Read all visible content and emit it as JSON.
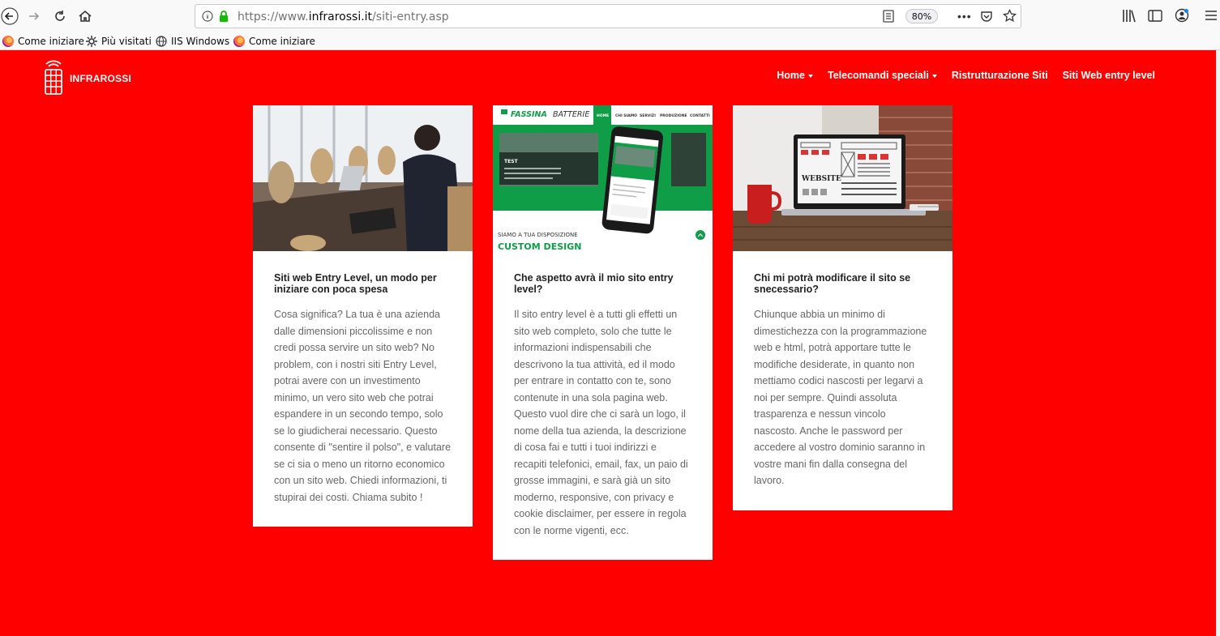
{
  "browser": {
    "url_prefix": "https://www.",
    "url_domain": "infrarossi.it",
    "url_path": "/siti-entry.asp",
    "zoom": "80%",
    "bookmarks": [
      {
        "label": "Come iniziare",
        "icon": "firefox-icon"
      },
      {
        "label": "Più visitati",
        "icon": "gear-icon"
      },
      {
        "label": "IIS Windows",
        "icon": "globe-icon"
      },
      {
        "label": "Come iniziare",
        "icon": "firefox-icon"
      }
    ]
  },
  "site": {
    "logo_text": "INFRAROSSI",
    "menu": [
      {
        "label": "Home",
        "dropdown": true
      },
      {
        "label": "Telecomandi speciali",
        "dropdown": true
      },
      {
        "label": "Ristrutturazione Siti",
        "dropdown": false
      },
      {
        "label": "Siti Web entry level",
        "dropdown": false
      }
    ],
    "accent_color": "#ff0000"
  },
  "cards": [
    {
      "image": "office-photo",
      "title": "Siti web Entry Level, un modo per iniziare con poca spesa",
      "text": "Cosa significa? La tua è una azienda dalle dimensioni piccolissime e non credi possa servire un sito web? No problem, con i nostri siti Entry Level, potrai avere con un investimento minimo, un vero sito web che potrai espandere in un secondo tempo, solo se lo giudicherai necessario. Questo consente di \"sentire il polso\", e valutare se ci sia o meno un ritorno economico con un sito web. Chiedi informazioni, ti stupirai dei costi. Chiama subito !"
    },
    {
      "image": "fassina-mockup",
      "image_texts": {
        "brand_a": "FASSINA",
        "brand_b": "BATTERIE",
        "nav": [
          "HOME",
          "CHI SIAMO",
          "SERVIZI",
          "PRODUZIONE",
          "CONTATTI"
        ],
        "test": "TEST",
        "tagline": "SIAMO A TUA DISPOSIZIONE",
        "headline": "CUSTOM DESIGN"
      },
      "title": "Che aspetto avrà il mio sito entry level?",
      "text": "Il sito entry level è a tutti gli effetti un sito web completo, solo che tutte le informazioni indispensabili che descrivono la tua attività, ed il modo per entrare in contatto con te, sono contenute in una sola pagina web. Questo vuol dire che ci sarà un logo, il nome della tua azienda, la descrizione di cosa fai e tutti i tuoi indirizzi e recapiti telefonici, email, fax, un paio di grosse immagini, e sarà già un sito moderno, responsive, con privacy e cookie disclaimer, per essere in regola con le norme vigenti, ecc."
    },
    {
      "image": "laptop-website-photo",
      "image_texts": {
        "screen_word": "WEBSITE"
      },
      "title": "Chi mi potrà modificare il sito se snecessario?",
      "text": "Chiunque abbia un minimo di dimestichezza con la programmazione web e html, potrà apportare tutte le modifiche desiderate, in quanto non mettiamo codici nascosti per legarvi a noi per sempre. Quindi assoluta trasparenza e nessun vincolo nascosto. Anche le password per accedere al vostro dominio saranno in vostre mani fin dalla consegna del lavoro."
    }
  ]
}
